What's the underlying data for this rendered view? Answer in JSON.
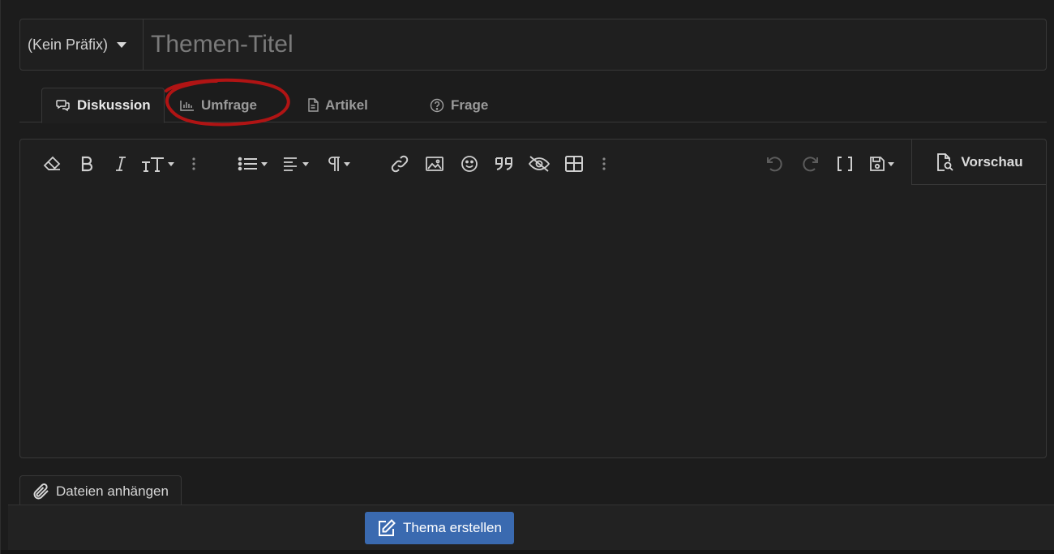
{
  "form": {
    "prefix_label": "(Kein Präfix)",
    "title_placeholder": "Themen-Titel",
    "title_value": ""
  },
  "tabs": [
    {
      "label": "Diskussion",
      "icon": "comments-icon",
      "active": true
    },
    {
      "label": "Umfrage",
      "icon": "chart-icon",
      "active": false,
      "annotated": true
    },
    {
      "label": "Artikel",
      "icon": "document-icon",
      "active": false
    },
    {
      "label": "Frage",
      "icon": "question-icon",
      "active": false
    }
  ],
  "toolbar": {
    "buttons": [
      "eraser-icon",
      "bold-icon",
      "italic-icon",
      "text-size-icon",
      "more-vertical-icon",
      "list-icon",
      "align-icon",
      "paragraph-icon",
      "link-icon",
      "image-icon",
      "smiley-icon",
      "quote-icon",
      "eye-slash-icon",
      "table-icon",
      "more-vertical-icon",
      "undo-icon",
      "redo-icon",
      "brackets-icon",
      "save-draft-icon"
    ],
    "preview_label": "Vorschau"
  },
  "attach": {
    "label": "Dateien anhängen"
  },
  "submit": {
    "label": "Thema erstellen"
  },
  "colors": {
    "background": "#1c1c1c",
    "panel": "#1f1f1f",
    "border": "#383838",
    "primary_button": "#3a6ab0",
    "annotation": "#b01414"
  }
}
